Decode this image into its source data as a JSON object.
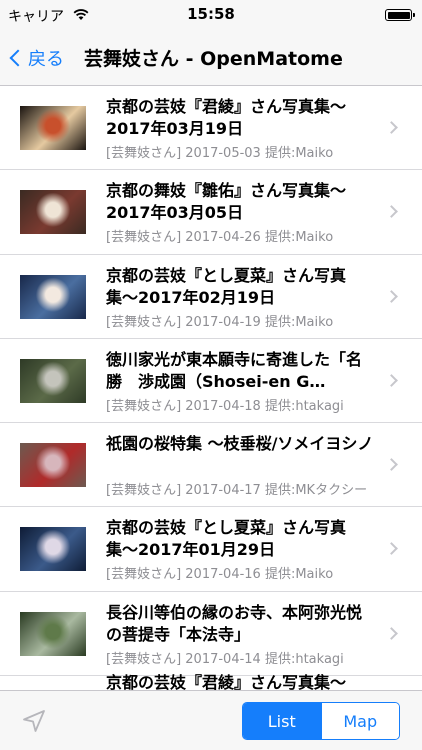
{
  "status": {
    "carrier": "キャリア",
    "time": "15:58"
  },
  "nav": {
    "back_label": "戻る",
    "title": "芸舞妓さん - OpenMatome"
  },
  "items": [
    {
      "title": "京都の芸妓『君綾』さん写真集〜2017年03月19日",
      "subtitle": "[芸舞妓さん] 2017-05-03 提供:Maiko",
      "thumb_colors": [
        "#1a1410",
        "#c8502c",
        "#e5c9a0"
      ]
    },
    {
      "title": "京都の舞妓『雛佑』さん写真集〜2017年03月05日",
      "subtitle": "[芸舞妓さん] 2017-04-26 提供:Maiko",
      "thumb_colors": [
        "#3a2a22",
        "#efe4d6",
        "#7a3a30"
      ]
    },
    {
      "title": "京都の芸妓『とし夏菜』さん写真集〜2017年02月19日",
      "subtitle": "[芸舞妓さん] 2017-04-19 提供:Maiko",
      "thumb_colors": [
        "#18284a",
        "#f3e9e0",
        "#4a6ea0"
      ]
    },
    {
      "title": "徳川家光が東本願寺に寄進した「名勝　渉成園（Shosei-en G…",
      "subtitle": "[芸舞妓さん] 2017-04-18 提供:htakagi",
      "thumb_colors": [
        "#2e3a26",
        "#c4c4bc",
        "#5b6a48"
      ]
    },
    {
      "title": "祇園の桜特集 〜枝垂桜/ソメイヨシノ",
      "subtitle": "[芸舞妓さん] 2017-04-17 提供:MKタクシー",
      "thumb_colors": [
        "#6c5a50",
        "#d7b6bc",
        "#b02a2a"
      ]
    },
    {
      "title": "京都の芸妓『とし夏菜』さん写真集〜2017年01月29日",
      "subtitle": "[芸舞妓さん] 2017-04-16 提供:Maiko",
      "thumb_colors": [
        "#0e1c36",
        "#dfd8e6",
        "#3b5a8a"
      ]
    },
    {
      "title": "長谷川等伯の縁のお寺、本阿弥光悦の菩提寺「本法寺」",
      "subtitle": "[芸舞妓さん] 2017-04-14 提供:htakagi",
      "thumb_colors": [
        "#2a3b22",
        "#5f7a4a",
        "#a9b9a0"
      ]
    },
    {
      "title": "京都の芸妓『君綾』さん写真集〜",
      "subtitle": "",
      "thumb_colors": [
        "#ffffff",
        "#ffffff",
        "#ffffff"
      ]
    }
  ],
  "toolbar": {
    "list_label": "List",
    "map_label": "Map"
  },
  "colors": {
    "accent": "#157efb",
    "subtitle": "#8e8e93",
    "bar_background": "#f7f7f7"
  }
}
